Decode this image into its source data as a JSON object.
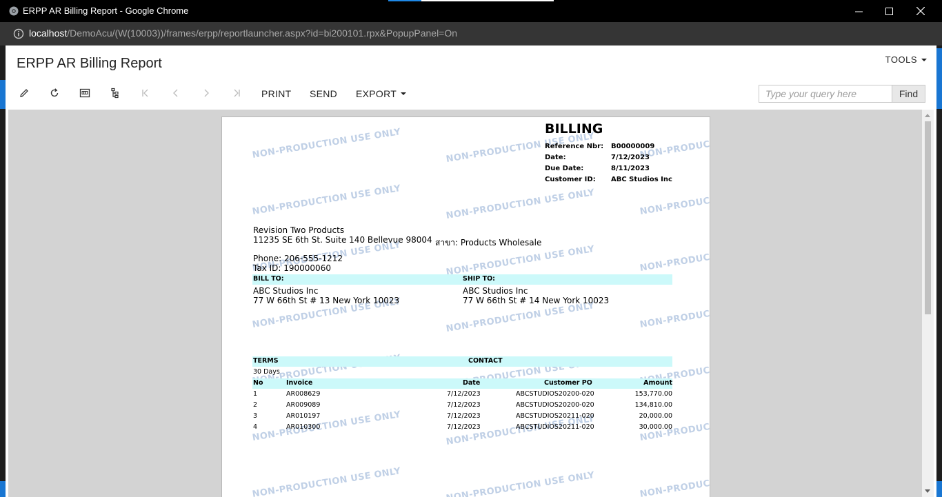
{
  "window": {
    "title": "ERPP AR Billing Report - Google Chrome",
    "url_host": "localhost",
    "url_path": "/DemoAcu/(W(10003))/frames/erpp/reportlauncher.aspx?id=bi200101.rpx&PopupPanel=On"
  },
  "header": {
    "title": "ERPP AR Billing Report",
    "tools_label": "TOOLS"
  },
  "toolbar": {
    "print_label": "PRINT",
    "send_label": "SEND",
    "export_label": "EXPORT",
    "search_placeholder": "Type your query here",
    "find_label": "Find"
  },
  "report": {
    "title": "BILLING",
    "meta": [
      {
        "label": "Reference Nbr:",
        "value": "B00000009"
      },
      {
        "label": "Date:",
        "value": "7/12/2023"
      },
      {
        "label": "Due Date:",
        "value": "8/11/2023"
      },
      {
        "label": "Customer ID:",
        "value": "ABC Studios Inc"
      }
    ],
    "company_name": "Revision Two Products",
    "company_address": "11235 SE 6th St. Suite 140 Bellevue 98004",
    "branch": "สาขา: Products Wholesale",
    "phone": "Phone: 206-555-1212",
    "tax_id": "Tax ID: 190000060",
    "bill_to_label": "BILL TO:",
    "ship_to_label": "SHIP TO:",
    "bill_to_name": "ABC Studios Inc",
    "bill_to_address": "77 W 66th St # 13 New York 10023",
    "ship_to_name": "ABC Studios Inc",
    "ship_to_address": "77 W 66th St # 14 New York 10023",
    "terms_label": "TERMS",
    "contact_label": "CONTACT",
    "terms_value": "30 Days",
    "columns": [
      "No",
      "Invoice",
      "Date",
      "Customer PO",
      "Amount"
    ],
    "rows": [
      [
        "1",
        "AR008629",
        "7/12/2023",
        "ABCSTUDIOS20200-020",
        "153,770.00"
      ],
      [
        "2",
        "AR009089",
        "7/12/2023",
        "ABCSTUDIOS20200-020",
        "134,810.00"
      ],
      [
        "3",
        "AR010197",
        "7/12/2023",
        "ABCSTUDIOS20211-020",
        "20,000.00"
      ],
      [
        "4",
        "AR010300",
        "7/12/2023",
        "ABCSTUDIOS20211-020",
        "30,000.00"
      ]
    ],
    "watermark": "NON-PRODUCTION USE ONLY",
    "watermark_short": "NON-PRODUC"
  }
}
